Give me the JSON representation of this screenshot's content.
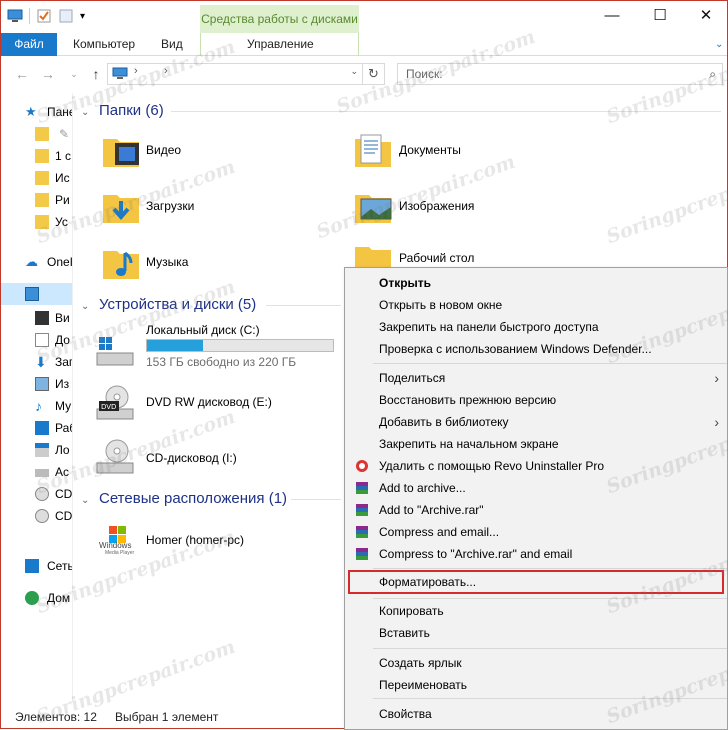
{
  "window": {
    "tools_tab": "Средства работы с дисками",
    "tabs": [
      "Файл",
      "Компьютер",
      "Вид"
    ],
    "tools_subtab": "Управление"
  },
  "search": {
    "placeholder": "Поиск:"
  },
  "nav": {
    "items": [
      {
        "label": "Пане",
        "icon": "star-icon"
      },
      {
        "label": "",
        "icon": "folder-icon"
      },
      {
        "label": "1 с",
        "icon": "folder-icon"
      },
      {
        "label": "Ис",
        "icon": "folder-icon"
      },
      {
        "label": "Ри",
        "icon": "folder-icon"
      },
      {
        "label": "Ус",
        "icon": "folder-icon"
      },
      {
        "label": "OneI",
        "icon": "cloud-icon"
      },
      {
        "label": "",
        "icon": "computer-icon"
      },
      {
        "label": "Ви",
        "icon": "video-icon"
      },
      {
        "label": "До",
        "icon": "document-icon"
      },
      {
        "label": "Заг",
        "icon": "download-icon"
      },
      {
        "label": "Из",
        "icon": "image-icon"
      },
      {
        "label": "Му",
        "icon": "music-icon"
      },
      {
        "label": "Раб",
        "icon": "desktop-icon"
      },
      {
        "label": "Ло",
        "icon": "windows-drive-icon"
      },
      {
        "label": "Ас",
        "icon": "drive-icon"
      },
      {
        "label": "CD",
        "icon": "cd-icon"
      },
      {
        "label": "CD",
        "icon": "cd-icon"
      },
      {
        "label": "Сеть",
        "icon": "network-icon"
      },
      {
        "label": "Дом",
        "icon": "homegroup-icon"
      }
    ]
  },
  "content": {
    "folders_header": "Папки (6)",
    "folders": [
      "Видео",
      "Документы",
      "Загрузки",
      "Изображения",
      "Музыка",
      "Рабочий стол"
    ],
    "devices_header": "Устройства и диски (5)",
    "local_disk": {
      "name": "Локальный диск (C:)",
      "free": "153 ГБ свободно из 220 ГБ",
      "used_fraction": 0.3
    },
    "dvd": "DVD RW дисковод (E:)",
    "cd": "CD-дисковод (I:)",
    "network_header": "Сетевые расположения (1)",
    "network_item": "Homer (homer-pc)",
    "network_logo_line1": "Windows",
    "network_logo_line2": "Media Player"
  },
  "menu": {
    "open": "Открыть",
    "open_new": "Открыть в новом окне",
    "pin_quick": "Закрепить на панели быстрого доступа",
    "defender": "Проверка с использованием Windows Defender...",
    "share": "Поделиться",
    "restore": "Восстановить прежнюю версию",
    "library": "Добавить в библиотеку",
    "pin_start": "Закрепить на начальном экране",
    "revo": "Удалить с помощью Revo Uninstaller Pro",
    "add_archive": "Add to archive...",
    "add_rar": "Add to \"Archive.rar\"",
    "compress_email": "Compress and email...",
    "compress_rar_email": "Compress to \"Archive.rar\" and email",
    "format": "Форматировать...",
    "copy": "Копировать",
    "paste": "Вставить",
    "shortcut": "Создать ярлык",
    "rename": "Переименовать",
    "properties": "Свойства"
  },
  "status": {
    "items": "Элементов: 12",
    "selected": "Выбран 1 элемент"
  },
  "watermark": "Soringpcrepair.com",
  "colors": {
    "accent": "#1979ca",
    "tools": "#dff0cf",
    "highlight": "#d52b2b",
    "header": "#1e3287"
  }
}
